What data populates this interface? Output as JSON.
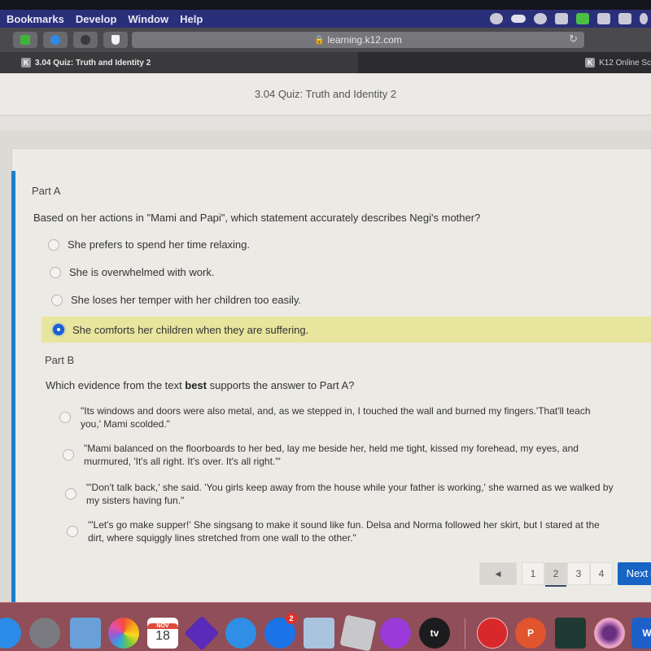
{
  "menubar": {
    "items": [
      "Bookmarks",
      "Develop",
      "Window",
      "Help"
    ],
    "status_icons": [
      "checkmark-badge-icon",
      "cloud-icon",
      "ghost-icon",
      "clipboard-icon",
      "green-app-icon",
      "play-icon",
      "airplay-icon",
      "bluetooth-icon"
    ]
  },
  "toolbar": {
    "extensions": [
      "green-extension-icon",
      "blue-extension-icon",
      "octocat-icon",
      "shield-icon"
    ],
    "address": "learning.k12.com",
    "lock_icon": "🔒",
    "reload_icon": "↻"
  },
  "tabs": [
    {
      "favicon": "K",
      "label": "3.04 Quiz: Truth and Identity 2",
      "active": true
    },
    {
      "favicon": "K",
      "label": "K12 Online Sc",
      "active": false
    }
  ],
  "page": {
    "title": "3.04 Quiz: Truth and Identity 2"
  },
  "part_a": {
    "label": "Part A",
    "question": "Based on her actions in \"Mami and Papi\", which statement accurately describes Negi's mother?",
    "options": [
      {
        "text": "She prefers to spend her time relaxing.",
        "selected": false
      },
      {
        "text": "She is overwhelmed with work.",
        "selected": false
      },
      {
        "text": "She loses her temper with her children too easily.",
        "selected": false
      },
      {
        "text": "She comforts her children when they are suffering.",
        "selected": true
      }
    ]
  },
  "part_b": {
    "label": "Part B",
    "question_pre": "Which evidence from the text ",
    "question_bold": "best",
    "question_post": " supports the answer to Part A?",
    "options": [
      {
        "line1": "\"Its windows and doors were also metal, and, as we stepped in, I touched the wall and burned my fingers.'That'll teach",
        "line2": "you,' Mami scolded.\"",
        "selected": false
      },
      {
        "line1": "\"Mami balanced on the floorboards to her bed, lay me beside her, held me tight, kissed my forehead, my eyes, and",
        "line2": "murmured, 'It's all right. It's over. It's all right.'\"",
        "selected": false
      },
      {
        "line1": "\"'Don't talk back,' she said. 'You girls keep away from the house while your father is working,' she warned as we walked by",
        "line2": "my sisters having fun.\"",
        "selected": false
      },
      {
        "line1": "\"'Let's go make supper!' She singsang to make it sound like fun. Delsa and Norma followed her skirt, but I stared at the",
        "line2": "dirt, where squiggly lines stretched from one wall to the other.\"",
        "selected": false
      }
    ]
  },
  "pagination": {
    "prev_icon": "◀",
    "pages": [
      "1",
      "2",
      "3",
      "4"
    ],
    "current_page": "2",
    "next_label": "Next ▸"
  },
  "dock": {
    "calendar_month": "NOV",
    "calendar_day": "18",
    "appstore_badge": "2",
    "appletv_label": "tv",
    "powerpoint_label": "P",
    "word_label": "W",
    "apps": [
      "safari",
      "launchpad",
      "mail",
      "photos",
      "calendar",
      "imovie",
      "messages",
      "app-store",
      "preview",
      "roblox",
      "podcasts",
      "apple-tv",
      "youtube",
      "powerpoint",
      "activity-monitor",
      "camera",
      "word"
    ]
  }
}
